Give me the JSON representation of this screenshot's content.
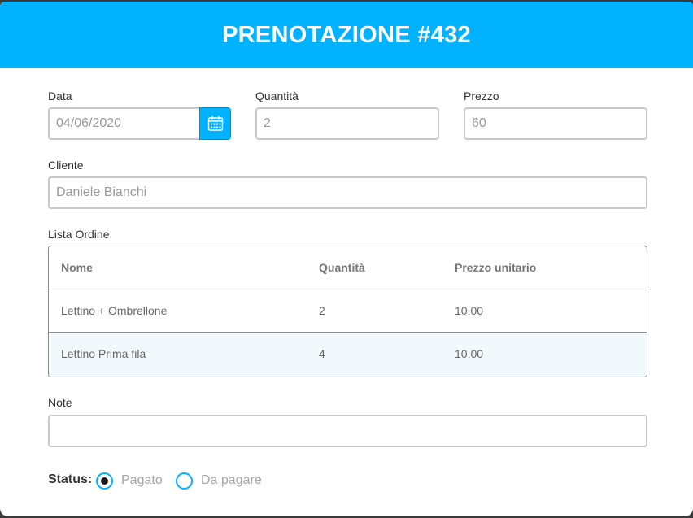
{
  "header": {
    "title": "PRENOTAZIONE #432"
  },
  "form": {
    "date": {
      "label": "Data",
      "value": "04/06/2020"
    },
    "quantity": {
      "label": "Quantità",
      "value": "2"
    },
    "price": {
      "label": "Prezzo",
      "value": "60"
    },
    "client": {
      "label": "Cliente",
      "value": "Daniele Bianchi"
    },
    "notes": {
      "label": "Note",
      "value": ""
    }
  },
  "order_list": {
    "label": "Lista Ordine",
    "columns": [
      "Nome",
      "Quantità",
      "Prezzo unitario"
    ],
    "rows": [
      {
        "name": "Lettino + Ombrellone",
        "quantity": "2",
        "unit_price": "10.00"
      },
      {
        "name": "Lettino Prima fila",
        "quantity": "4",
        "unit_price": "10.00"
      }
    ]
  },
  "status": {
    "label": "Status:",
    "options": [
      {
        "label": "Pagato",
        "selected": true
      },
      {
        "label": "Da pagare",
        "selected": false
      }
    ]
  },
  "colors": {
    "accent": "#00b2ff",
    "row_highlight": "#f1f9fc"
  },
  "icons": {
    "date_picker": "calendar-icon"
  }
}
